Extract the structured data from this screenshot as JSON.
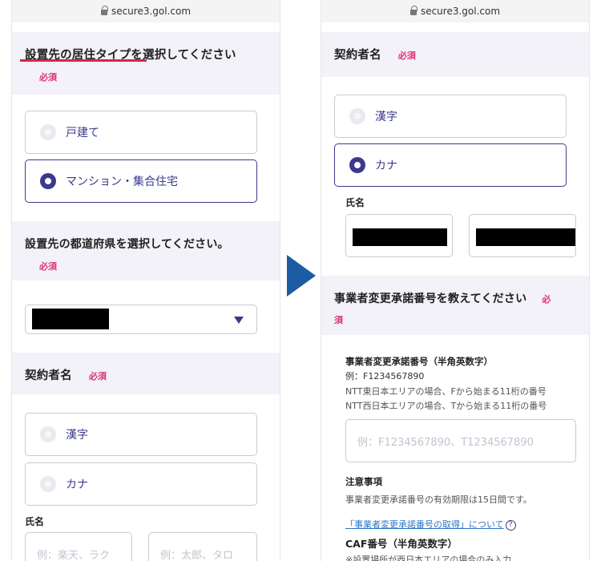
{
  "left": {
    "url": "secure3.gol.com",
    "residence": {
      "title": "設置先の居住タイプを選択してください",
      "required": "必須",
      "options": [
        {
          "label": "戸建て",
          "selected": false
        },
        {
          "label": "マンション・集合住宅",
          "selected": true
        }
      ]
    },
    "prefecture": {
      "title": "設置先の都道府県を選択してください。",
      "required": "必須",
      "selected_value": ""
    },
    "contractor": {
      "title": "契約者名",
      "required": "必須",
      "options": [
        {
          "label": "漢字",
          "selected": false
        },
        {
          "label": "カナ",
          "selected": false
        }
      ]
    },
    "name": {
      "label": "氏名",
      "last_placeholder": "例：楽天、ラク",
      "first_placeholder": "例：太郎、タロ"
    }
  },
  "right": {
    "url": "secure3.gol.com",
    "contractor": {
      "title": "契約者名",
      "required": "必須",
      "options": [
        {
          "label": "漢字",
          "selected": false
        },
        {
          "label": "カナ",
          "selected": true
        }
      ]
    },
    "name": {
      "label": "氏名"
    },
    "approval": {
      "title_line1": "事業者変更承諾番号を教えてください",
      "required_first": "必",
      "required_second": "須",
      "field_label": "事業者変更承諾番号（半角英数字）",
      "example": "例：F1234567890",
      "note_east": "NTT東日本エリアの場合、Fから始まる11桁の番号",
      "note_west": "NTT西日本エリアの場合、Tから始まる11桁の番号",
      "placeholder": "例：F1234567890、T1234567890"
    },
    "caution": {
      "heading": "注意事項",
      "text": "事業者変更承諾番号の有効期限は15日間です。",
      "link": "「事業者変更承諾番号の取得」について",
      "help_icon": "?"
    },
    "caf": {
      "label": "CAF番号（半角英数字）",
      "note": "※設置場所が西日本エリアの場合のみ入力"
    }
  },
  "colors": {
    "accent": "#3b3a8c",
    "required": "#e0307a",
    "arrow": "#1c5ca3",
    "section_bg": "#f2f2f8"
  }
}
